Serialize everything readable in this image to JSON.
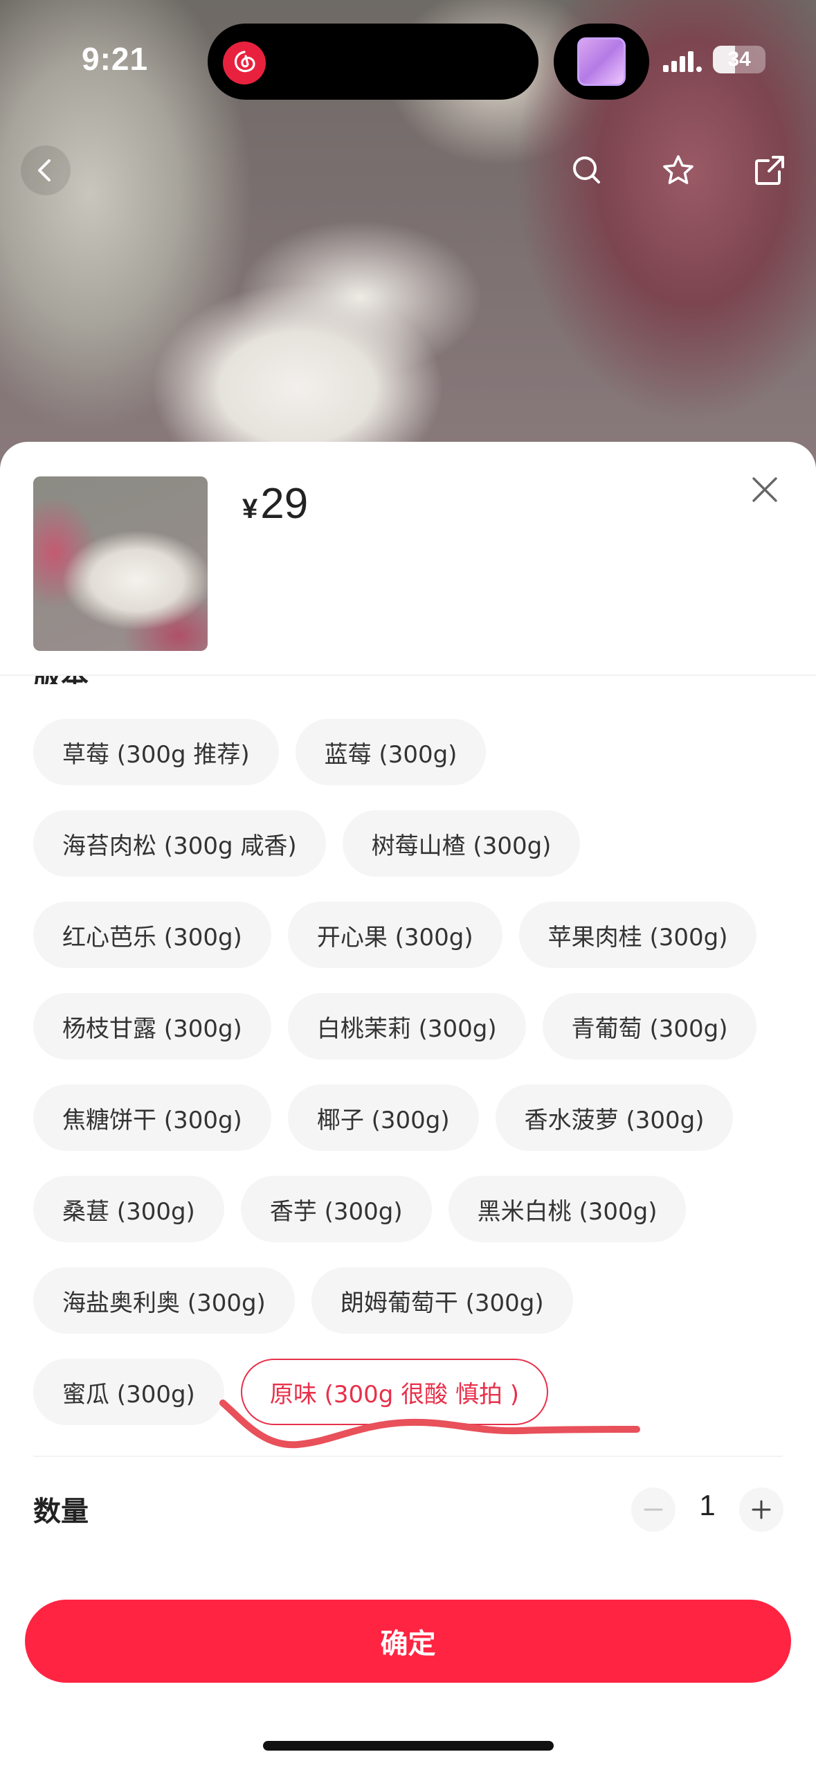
{
  "status_bar": {
    "time": "9:21",
    "battery": "34",
    "island_app_icon": "netease-music-icon"
  },
  "nav": {
    "back_icon": "chevron-left-icon",
    "search_icon": "search-icon",
    "favorite_icon": "star-icon",
    "share_icon": "share-icon"
  },
  "product": {
    "price_symbol": "¥",
    "price": "29"
  },
  "variants": {
    "section_title": "版本",
    "rows": [
      [
        "草莓 (300g 推荐)",
        "蓝莓 (300g)"
      ],
      [
        "海苔肉松 (300g 咸香)",
        "树莓山楂 (300g)"
      ],
      [
        "红心芭乐 (300g)",
        "开心果 (300g)",
        "苹果肉桂 (300g)"
      ],
      [
        "杨枝甘露 (300g)",
        "白桃茉莉 (300g)",
        "青葡萄 (300g)"
      ],
      [
        "焦糖饼干 (300g)",
        "椰子 (300g)",
        "香水菠萝 (300g)"
      ],
      [
        "桑葚 (300g)",
        "香芋 (300g)",
        "黑米白桃 (300g)"
      ],
      [
        "海盐奥利奥 (300g)",
        "朗姆葡萄干 (300g)"
      ],
      [
        "蜜瓜 (300g)",
        "原味 (300g 很酸 慎拍 )"
      ]
    ],
    "selected": "原味 (300g 很酸 慎拍 )"
  },
  "quantity": {
    "label": "数量",
    "value": "1"
  },
  "confirm_label": "确定",
  "colors": {
    "accent": "#ff2442",
    "selected_text": "#e8304a",
    "chip_bg": "#f5f5f5",
    "scribble": "#e8505a"
  }
}
